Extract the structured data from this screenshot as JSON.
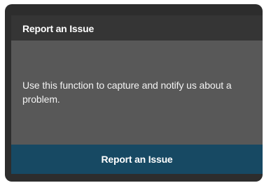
{
  "panel": {
    "title": "Report an Issue",
    "description": "Use this function to capture and notify us about a problem.",
    "button_label": "Report an Issue"
  },
  "colors": {
    "panel_bg": "#2d2d2d",
    "header_bg": "#353535",
    "body_bg": "#585858",
    "button_bg": "#174963"
  }
}
